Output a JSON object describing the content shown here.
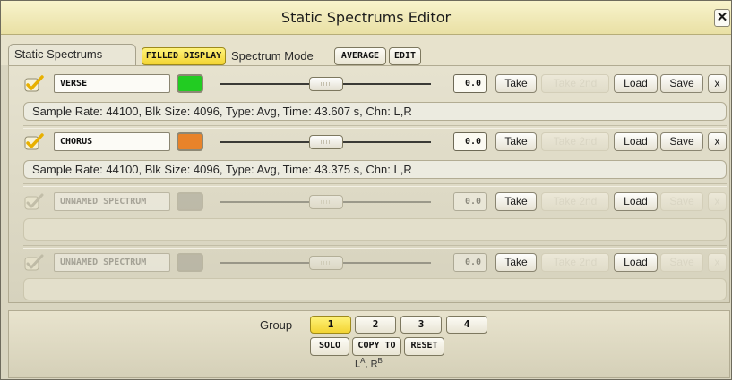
{
  "window": {
    "title": "Static Spectrums Editor",
    "close_label": "✕"
  },
  "tabs": {
    "static_spectrums": "Static Spectrums"
  },
  "toolbar": {
    "filled_display": "FILLED DISPLAY",
    "spectrum_mode_label": "Spectrum Mode",
    "average": "AVERAGE",
    "edit": "EDIT"
  },
  "buttons": {
    "take": "Take",
    "take_2nd": "Take 2nd",
    "load": "Load",
    "save": "Save",
    "remove": "x"
  },
  "slots": [
    {
      "enabled": true,
      "name": "VERSE",
      "color": "#22cc22",
      "value": "0.0",
      "slider": 0.5,
      "info": "Sample Rate: 44100, Blk Size: 4096, Type: Avg, Time: 43.607 s, Chn: L,R"
    },
    {
      "enabled": true,
      "name": "CHORUS",
      "color": "#e8832a",
      "value": "0.0",
      "slider": 0.5,
      "info": "Sample Rate: 44100, Blk Size: 4096, Type: Avg, Time: 43.375 s, Chn: L,R"
    },
    {
      "enabled": false,
      "name": "UNNAMED SPECTRUM",
      "color": "#8f8c80",
      "value": "0.0",
      "slider": 0.5,
      "info": ""
    },
    {
      "enabled": false,
      "name": "UNNAMED SPECTRUM",
      "color": "#8f8c80",
      "value": "0.0",
      "slider": 0.5,
      "info": ""
    }
  ],
  "footer": {
    "group_label": "Group",
    "groups": [
      "1",
      "2",
      "3",
      "4"
    ],
    "active_group": "1",
    "solo": "SOLO",
    "copy_to": "COPY TO",
    "reset": "RESET",
    "routing_l": "L",
    "routing_l_sup": "A",
    "routing_sep": ", R",
    "routing_r_sup": "B"
  }
}
